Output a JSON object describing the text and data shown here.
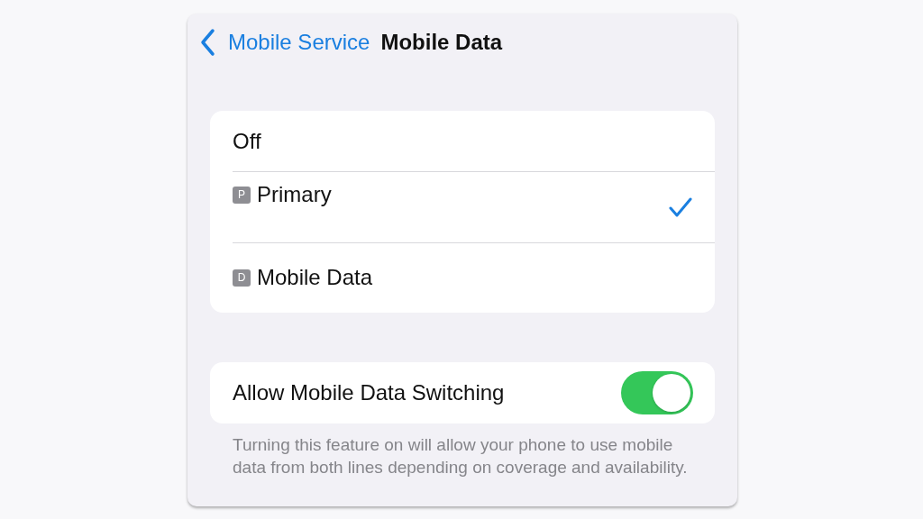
{
  "nav": {
    "back_label": "Mobile Service",
    "title": "Mobile Data"
  },
  "options": [
    {
      "label": "Off",
      "selected": false
    },
    {
      "badge": "P",
      "label": "Primary",
      "selected": true
    },
    {
      "badge": "D",
      "label": "Mobile Data",
      "selected": false
    }
  ],
  "switch_row": {
    "label": "Allow Mobile Data Switching",
    "on": true
  },
  "footer": "Turning this feature on will allow your phone to use mobile data from both lines depending on coverage and availability."
}
